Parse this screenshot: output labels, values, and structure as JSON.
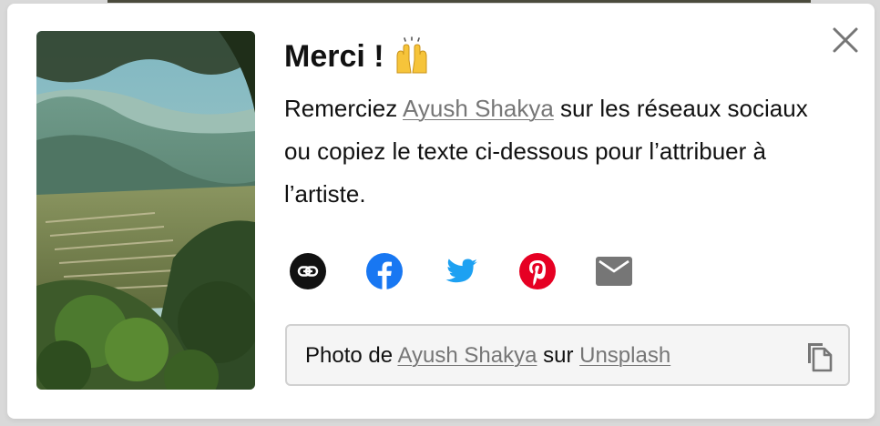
{
  "modal": {
    "title": "Merci !",
    "title_emoji": "raised-hands-icon",
    "description_before": "Remerciez ",
    "author_name": "Ayush Shakya",
    "description_after": " sur les réseaux sociaux ou copiez le texte ci-dessous pour l’attribuer à l’artiste.",
    "close_icon": "close-icon"
  },
  "share": {
    "buttons": [
      {
        "name": "link",
        "icon": "link-icon",
        "color": "#111111"
      },
      {
        "name": "facebook",
        "icon": "facebook-icon",
        "color": "#1877f2"
      },
      {
        "name": "twitter",
        "icon": "twitter-icon",
        "color": "#1da1f2"
      },
      {
        "name": "pinterest",
        "icon": "pinterest-icon",
        "color": "#e60023"
      },
      {
        "name": "email",
        "icon": "email-icon",
        "color": "#767676"
      }
    ]
  },
  "attribution": {
    "prefix": "Photo de ",
    "author": "Ayush Shakya",
    "middle": " sur ",
    "site": "Unsplash",
    "copy_icon": "copy-icon"
  },
  "colors": {
    "link": "#767676",
    "text": "#111111",
    "box_bg": "#f5f5f5",
    "box_border": "#d1d1d1"
  }
}
